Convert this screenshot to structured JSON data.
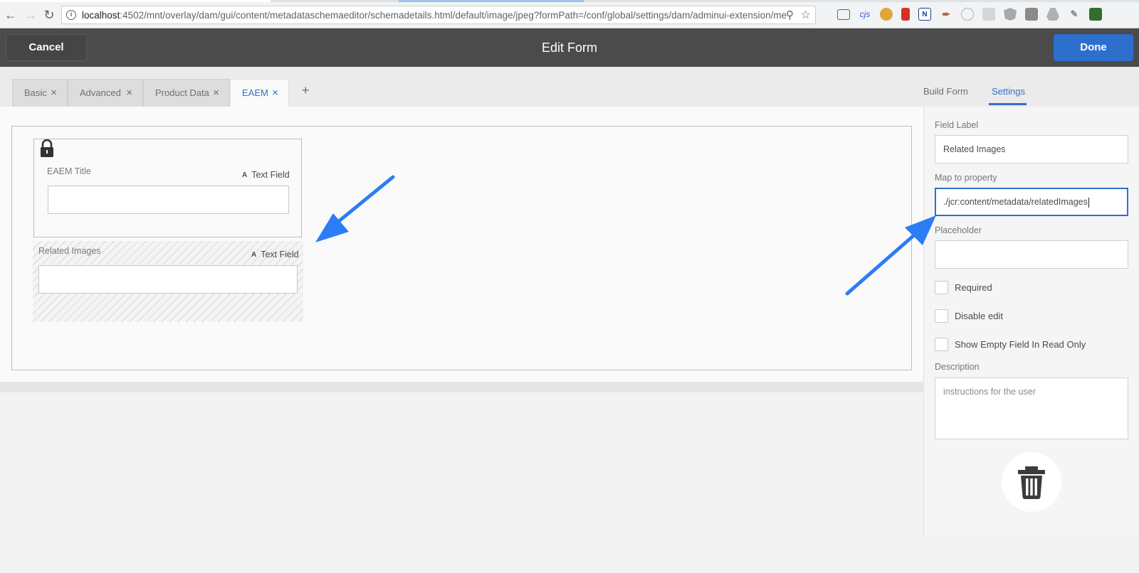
{
  "browser": {
    "url_host": "localhost",
    "url_rest": ":4502/mnt/overlay/dam/gui/content/metadataschemaeditor/schemadetails.html/default/image/jpeg?formPath=/conf/global/settings/dam/adminui-extension/me",
    "extension_cjs": "cjs",
    "extension_n": "N"
  },
  "header": {
    "cancel_label": "Cancel",
    "title": "Edit Form",
    "done_label": "Done"
  },
  "tabs": [
    {
      "label": "Basic",
      "close": "×"
    },
    {
      "label": "Advanced",
      "close": "×"
    },
    {
      "label": "Product Data",
      "close": "×"
    },
    {
      "label": "EAEM",
      "close": "×"
    }
  ],
  "tab_add": "+",
  "canvas": {
    "fields": [
      {
        "label": "EAEM Title",
        "type_glyph": "A",
        "type": "Text Field"
      },
      {
        "label": "Related Images",
        "type_glyph": "A",
        "type": "Text Field"
      }
    ]
  },
  "right_panel": {
    "tabs": {
      "build_form": "Build Form",
      "settings": "Settings"
    },
    "field_label_label": "Field Label",
    "field_label_value": "Related Images",
    "map_to_property_label": "Map to property",
    "map_to_property_value": "./jcr:content/metadata/relatedImages",
    "placeholder_label": "Placeholder",
    "placeholder_value": "",
    "checkboxes": [
      {
        "label": "Required",
        "checked": false
      },
      {
        "label": "Disable edit",
        "checked": false
      },
      {
        "label": "Show Empty Field In Read Only",
        "checked": false
      }
    ],
    "description_label": "Description",
    "description_placeholder": "instructions for the user"
  },
  "colors": {
    "header_bg": "#4b4b4b",
    "accent": "#2d6fcd",
    "arrow": "#2b7df5"
  }
}
